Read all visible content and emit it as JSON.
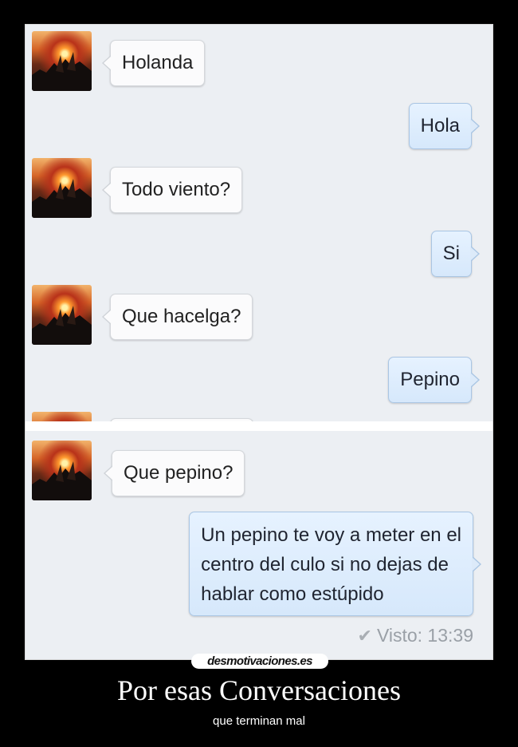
{
  "conversation": {
    "top": {
      "msg1": "Holanda",
      "msg2": "Hola",
      "msg3": "Todo viento?",
      "msg4": "Si",
      "msg5": "Que hacelga?",
      "msg6": "Pepino"
    },
    "bottom": {
      "msg7": "Que pepino?",
      "msg8_lines": [
        "Un pepino te voy a meter en el",
        "centro del culo si no dejas de",
        "hablar como estúpido"
      ],
      "seen": "Visto: 13:39"
    },
    "colors": {
      "outgoing_bubble": "#d6e8fb",
      "incoming_bubble": "#fbfbfc",
      "background": "#eceff3"
    }
  },
  "poster": {
    "watermark": "desmotivaciones.es",
    "title": "Por esas Conversaciones",
    "subtitle": "que terminan mal"
  }
}
